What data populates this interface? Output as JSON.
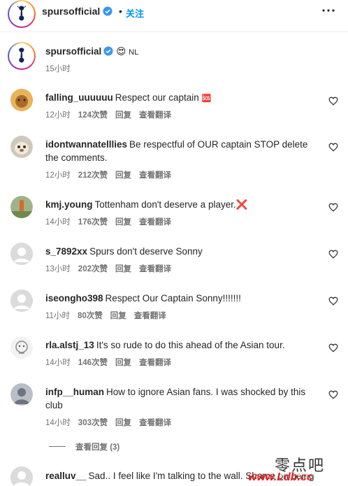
{
  "header": {
    "username": "spursofficial",
    "separator": "•",
    "follow_label": "关注",
    "more_icon": "more-horizontal-icon"
  },
  "caption": {
    "username": "spursofficial",
    "emoji": "😍",
    "flag_text": "NL",
    "time": "15小时"
  },
  "comments": [
    {
      "username": "falling_uuuuuu",
      "text": "Respect our captain",
      "emoji": "🆘",
      "time": "12小时",
      "likes": "124次赞",
      "reply": "回复",
      "translate": "查看翻译"
    },
    {
      "username": "idontwannatelllies",
      "text": "Be respectful of OUR captain STOP delete the comments.",
      "time": "12小时",
      "likes": "212次赞",
      "reply": "回复",
      "translate": "查看翻译"
    },
    {
      "username": "kmj.young",
      "text": "Tottenham don't deserve a player.",
      "emoji": "❌",
      "time": "14小时",
      "likes": "176次赞",
      "reply": "回复",
      "translate": "查看翻译"
    },
    {
      "username": "s_7892xx",
      "text": "Spurs don't deserve Sonny",
      "time": "13小时",
      "likes": "202次赞",
      "reply": "回复",
      "translate": "查看翻译"
    },
    {
      "username": "iseongho398",
      "text": "Respect Our Captain Sonny!!!!!!!",
      "time": "11小时",
      "likes": "80次赞",
      "reply": "回复",
      "translate": "查看翻译"
    },
    {
      "username": "rla.alstj_13",
      "text": "It's so rude to do this ahead of the Asian tour.",
      "time": "14小时",
      "likes": "146次赞",
      "reply": "回复",
      "translate": "查看翻译"
    },
    {
      "username": "infp__human",
      "text": "How to ignore Asian fans. I was shocked by this club",
      "time": "14小时",
      "likes": "303次赞",
      "reply": "回复",
      "translate": "查看翻译"
    }
  ],
  "view_replies": "查看回复 (3)",
  "last_comment": {
    "username": "realluv__",
    "text": "Sad.. I feel like I'm talking to the wall. Shame on being"
  },
  "watermark": {
    "chinese": "零点吧",
    "url": "www.Ldb.cc"
  },
  "colors": {
    "link_blue": "#0095f6",
    "meta_gray": "#737373",
    "text": "#262626",
    "verified_blue": "#3897f0",
    "watermark_red": "#e02020"
  }
}
